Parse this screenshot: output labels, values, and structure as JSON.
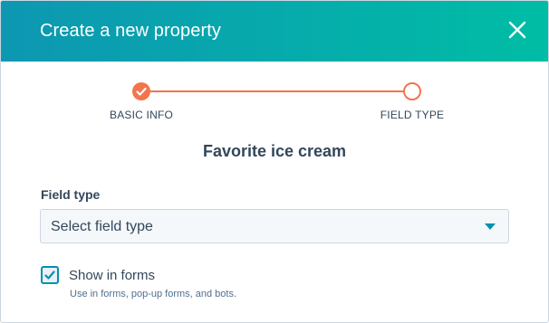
{
  "modal": {
    "title": "Create a new property",
    "close_icon": "close-icon"
  },
  "stepper": {
    "steps": [
      {
        "label": "BASIC INFO",
        "status": "complete"
      },
      {
        "label": "FIELD TYPE",
        "status": "current"
      }
    ],
    "accent_color": "#f2754e"
  },
  "property": {
    "name": "Favorite ice cream"
  },
  "field_type": {
    "label": "Field type",
    "selected": "Select field type"
  },
  "show_in_forms": {
    "label": "Show in forms",
    "help": "Use in forms, pop-up forms, and bots.",
    "checked": true
  },
  "colors": {
    "header_gradient_start": "#0d97b2",
    "header_gradient_end": "#00bda5",
    "text": "#33475b",
    "link": "#0091ae"
  }
}
